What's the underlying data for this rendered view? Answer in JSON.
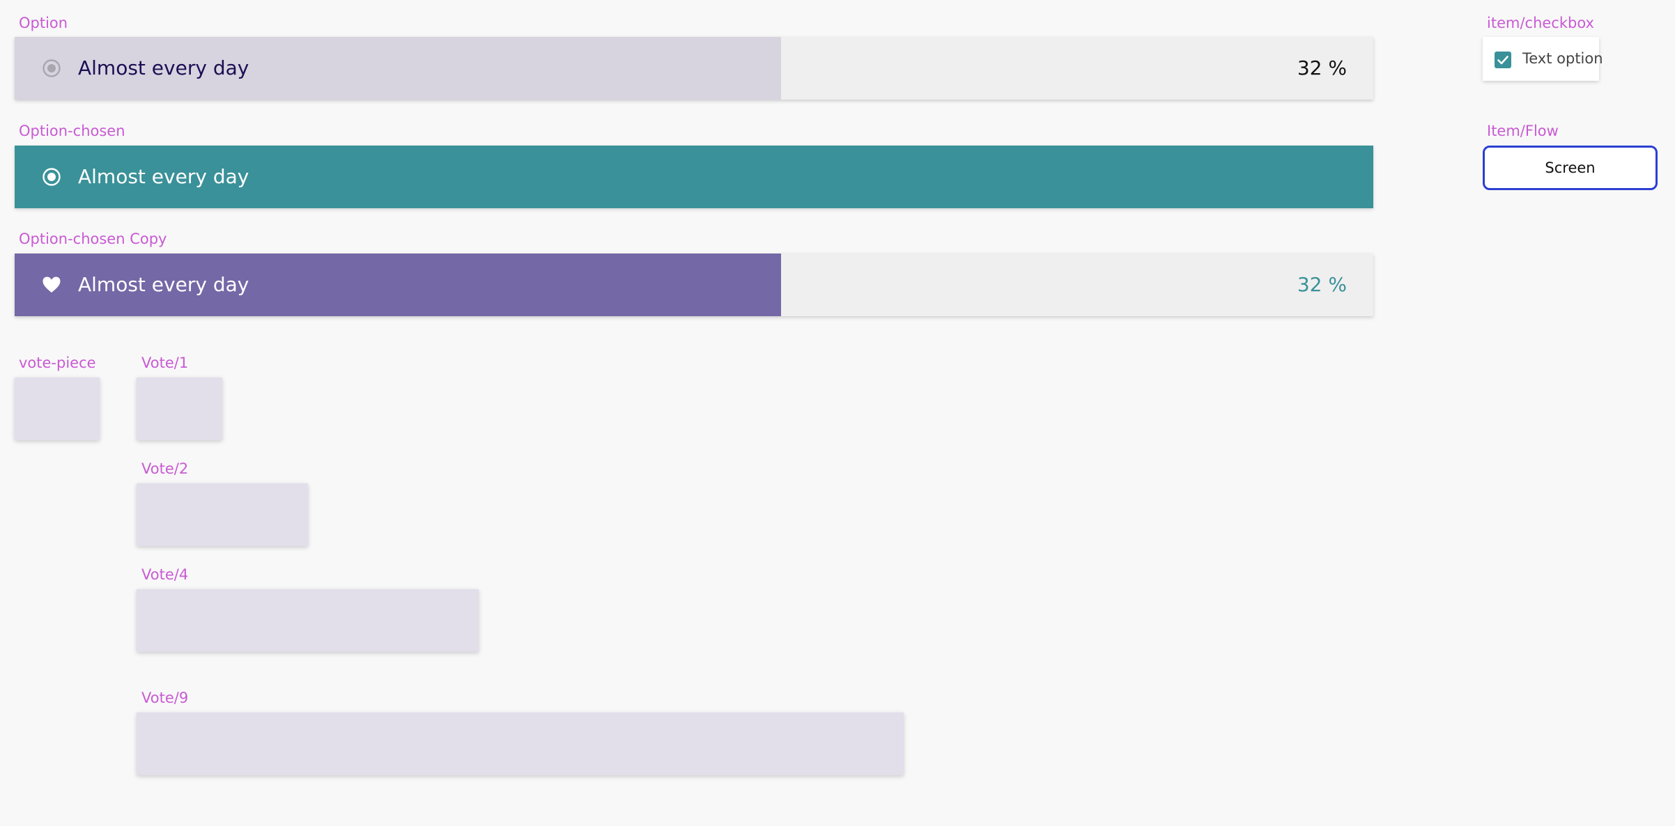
{
  "labels": {
    "option": "Option",
    "option_chosen": "Option-chosen",
    "option_chosen_copy": "Option-chosen Copy",
    "vote_piece": "vote-piece",
    "vote_1": "Vote/1",
    "vote_2": "Vote/2",
    "vote_4": "Vote/4",
    "vote_9": "Vote/9",
    "item_checkbox": "item/checkbox",
    "item_flow": "Item/Flow"
  },
  "options": [
    {
      "text": "Almost every day",
      "percent_text": "32 %",
      "fill_fraction": 0.564,
      "icon": "radio-unselected-icon",
      "fill_color": "#d7d4e0"
    },
    {
      "text": "Almost every day",
      "icon": "radio-selected-icon",
      "fill_color": "#3a9199"
    },
    {
      "text": "Almost every day",
      "percent_text": "32 %",
      "fill_fraction": 0.564,
      "icon": "heart-icon",
      "fill_color": "#7468a6"
    }
  ],
  "checkbox_item": {
    "text": "Text option",
    "checked": true,
    "color": "#3a9199"
  },
  "flow_item": {
    "text": "Screen",
    "border_color": "#2b3fd2"
  },
  "colors": {
    "label": "#c95ad4",
    "teal": "#3a9199",
    "purple": "#7468a6",
    "vote_piece": "#e2dfeb"
  }
}
